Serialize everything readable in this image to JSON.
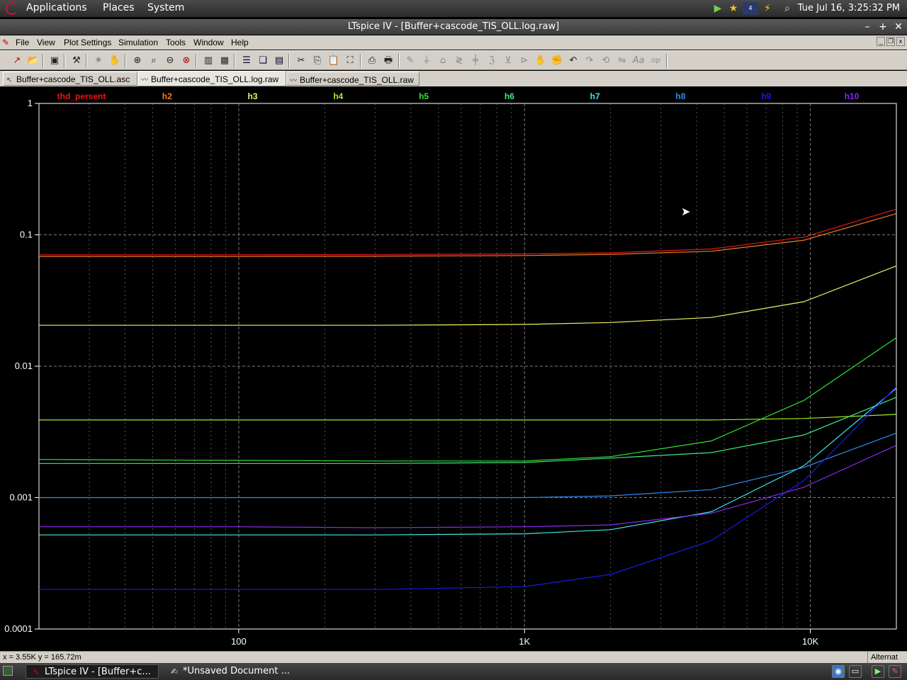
{
  "top_panel": {
    "menus": [
      "Applications",
      "Places",
      "System"
    ],
    "clock": "Tue Jul 16,  3:25:32 PM",
    "tray_icons": [
      "play-arrow-icon",
      "star-icon",
      "app-thumbnail-icon",
      "lightning-icon",
      "search-icon"
    ]
  },
  "window": {
    "title": "LTspice IV - [Buffer+cascode_TIS_OLL.log.raw]",
    "controls": [
      "minimize",
      "maximize",
      "close"
    ]
  },
  "menubar": {
    "items": [
      "File",
      "View",
      "Plot Settings",
      "Simulation",
      "Tools",
      "Window",
      "Help"
    ]
  },
  "toolbar": {
    "icons": [
      "new-schematic-icon",
      "open-icon",
      "save-icon",
      "control-panel-icon",
      "run-icon",
      "halt-icon",
      "pan-icon",
      "zoom-in-icon",
      "zoom-area-icon",
      "zoom-out-icon",
      "zoom-fit-icon",
      "autorange-icon",
      "zoom-full-icon",
      "tile-horizontal-icon",
      "cascade-icon",
      "tile-vertical-icon",
      "cut-icon",
      "copy-icon",
      "paste-icon",
      "find-icon",
      "print-preview-icon",
      "print-icon",
      "wire-icon",
      "ground-icon",
      "label-icon",
      "resistor-icon",
      "capacitor-icon",
      "inductor-icon",
      "diode-icon",
      "component-icon",
      "move-icon",
      "drag-icon",
      "undo-icon",
      "redo-icon",
      "rotate-icon",
      "mirror-icon",
      "text-icon",
      "spice-directive-icon"
    ]
  },
  "tabs": [
    {
      "label": "Buffer+cascode_TIS_OLL.asc",
      "icon": "schematic-icon",
      "active": false
    },
    {
      "label": "Buffer+cascode_TIS_OLL.log.raw",
      "icon": "waveform-icon",
      "active": true
    },
    {
      "label": "Buffer+cascode_TIS_OLL.raw",
      "icon": "waveform-icon",
      "active": false
    }
  ],
  "statusbar": {
    "coords": "x = 3.55K    y = 165.72m",
    "right_text": "Alternat"
  },
  "taskbar": {
    "tasks": [
      {
        "label": "LTspice IV - [Buffer+c...",
        "icon": "ltspice-icon",
        "active": true
      },
      {
        "label": "*Unsaved Document ...",
        "icon": "text-editor-icon",
        "active": false
      }
    ],
    "tray_icons": [
      "network-icon",
      "display-icon",
      "play-icon",
      "ltspice-tray-icon"
    ]
  },
  "colors": {
    "thd_persent": "#e8161e",
    "h2": "#f07a1e",
    "h3": "#f0f060",
    "h4": "#a0f020",
    "h5": "#30e030",
    "h6": "#40e880",
    "h7": "#40e8e8",
    "h8": "#2e8cf0",
    "h9": "#1a1ae8",
    "h10": "#8a28f0",
    "grid": "#8a8a8a",
    "axis": "#ffffff"
  },
  "chart_data": {
    "type": "line",
    "xscale": "log",
    "yscale": "log",
    "xlim": [
      20,
      20000
    ],
    "ylim": [
      0.0001,
      1
    ],
    "x_tick_labels": [
      "100",
      "1K",
      "10K"
    ],
    "x_tick_values": [
      100,
      1000,
      10000
    ],
    "y_tick_labels": [
      "1",
      "0.1",
      "0.01",
      "0.001",
      "0.0001"
    ],
    "y_tick_values": [
      1,
      0.1,
      0.01,
      0.001,
      0.0001
    ],
    "grid": true,
    "x": [
      20,
      100,
      300,
      1000,
      2000,
      4500,
      9500,
      20000
    ],
    "series": [
      {
        "name": "thd_persent",
        "values": [
          0.0705,
          0.0705,
          0.0708,
          0.0715,
          0.073,
          0.078,
          0.096,
          0.157
        ]
      },
      {
        "name": "h2",
        "values": [
          0.0685,
          0.0685,
          0.0688,
          0.0695,
          0.071,
          0.075,
          0.091,
          0.145
        ]
      },
      {
        "name": "h3",
        "values": [
          0.0205,
          0.0205,
          0.0205,
          0.0208,
          0.0215,
          0.0235,
          0.031,
          0.058
        ]
      },
      {
        "name": "h4",
        "values": [
          0.0039,
          0.0039,
          0.0039,
          0.0039,
          0.0039,
          0.0039,
          0.004,
          0.0043
        ]
      },
      {
        "name": "h5",
        "values": [
          0.00195,
          0.00192,
          0.0019,
          0.0019,
          0.00205,
          0.0027,
          0.0055,
          0.0165
        ]
      },
      {
        "name": "h6",
        "values": [
          0.00182,
          0.00182,
          0.00182,
          0.00185,
          0.002,
          0.0022,
          0.003,
          0.0058
        ]
      },
      {
        "name": "h7",
        "values": [
          0.00052,
          0.00052,
          0.00052,
          0.00053,
          0.00057,
          0.00078,
          0.00175,
          0.0068
        ]
      },
      {
        "name": "h8",
        "values": [
          0.001,
          0.001,
          0.001,
          0.001,
          0.00103,
          0.00115,
          0.0017,
          0.0031
        ]
      },
      {
        "name": "h9",
        "values": [
          0.0002,
          0.0002,
          0.0002,
          0.00021,
          0.00026,
          0.00047,
          0.00135,
          0.007
        ]
      },
      {
        "name": "h10",
        "values": [
          0.0006,
          0.0006,
          0.00059,
          0.0006,
          0.00062,
          0.00076,
          0.0012,
          0.0025
        ]
      }
    ]
  }
}
